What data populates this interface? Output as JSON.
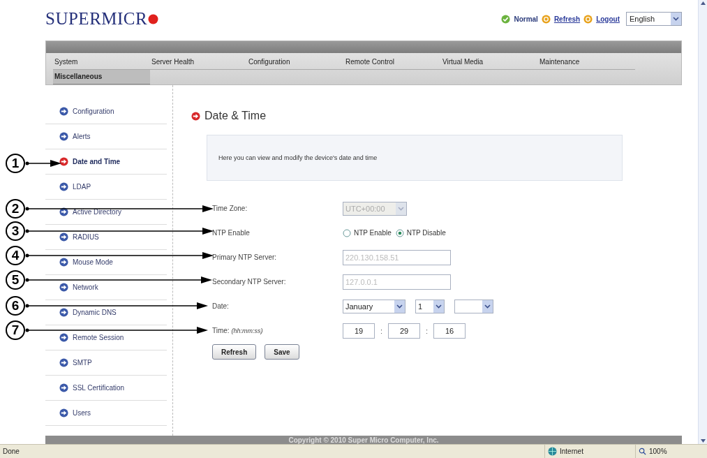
{
  "header": {
    "logo": "SUPERMICR",
    "status": "Normal",
    "links": [
      "Refresh",
      "Logout"
    ],
    "language": "English"
  },
  "nav": {
    "tabs": [
      {
        "label": "System",
        "selected": false
      },
      {
        "label": "Server Health",
        "selected": false
      },
      {
        "label": "Configuration",
        "selected": false
      },
      {
        "label": "Remote Control",
        "selected": false
      },
      {
        "label": "Virtual Media",
        "selected": false
      },
      {
        "label": "Maintenance",
        "selected": false
      },
      {
        "label": "Miscellaneous",
        "selected": true
      }
    ]
  },
  "sidebar": {
    "items": [
      {
        "label": "Configuration",
        "selected": false
      },
      {
        "label": "Alerts",
        "selected": false
      },
      {
        "label": "Date and Time",
        "selected": true
      },
      {
        "label": "LDAP",
        "selected": false
      },
      {
        "label": "Active Directory",
        "selected": false
      },
      {
        "label": "RADIUS",
        "selected": false
      },
      {
        "label": "Mouse Mode",
        "selected": false
      },
      {
        "label": "Network",
        "selected": false
      },
      {
        "label": "Dynamic DNS",
        "selected": false
      },
      {
        "label": "Remote Session",
        "selected": false
      },
      {
        "label": "SMTP",
        "selected": false
      },
      {
        "label": "SSL Certification",
        "selected": false
      },
      {
        "label": "Users",
        "selected": false
      }
    ]
  },
  "page": {
    "title": "Date & Time",
    "description": "Here you can view and modify the device's date and time",
    "form": [
      {
        "kind": "select",
        "label": "Time Zone:",
        "value": "UTC+00:00",
        "disabled": true
      },
      {
        "kind": "radio",
        "label": "NTP Enable",
        "options": [
          {
            "label": "NTP Enable",
            "selected": false
          },
          {
            "label": "NTP Disable",
            "selected": true
          }
        ]
      },
      {
        "kind": "text",
        "label": "Primary NTP Server:",
        "value": "220.130.158.51",
        "disabled": true
      },
      {
        "kind": "text",
        "label": "Secondary NTP Server:",
        "value": "127.0.0.1",
        "disabled": true
      },
      {
        "kind": "date",
        "label": "Date:",
        "month": "January",
        "day": "1"
      },
      {
        "kind": "time",
        "label": "Time:",
        "hint": "(hh:mm:ss)",
        "values": [
          "19",
          "29",
          "16"
        ],
        "separator": ":"
      }
    ],
    "buttons": [
      "Refresh",
      "Save"
    ]
  },
  "footer": "Copyright © 2010 Super Micro Computer, Inc.",
  "status_bar": {
    "status": "Done",
    "zone": "Internet",
    "zoom": "100%"
  },
  "callouts": [
    "1",
    "2",
    "3",
    "4",
    "5",
    "6",
    "7"
  ]
}
